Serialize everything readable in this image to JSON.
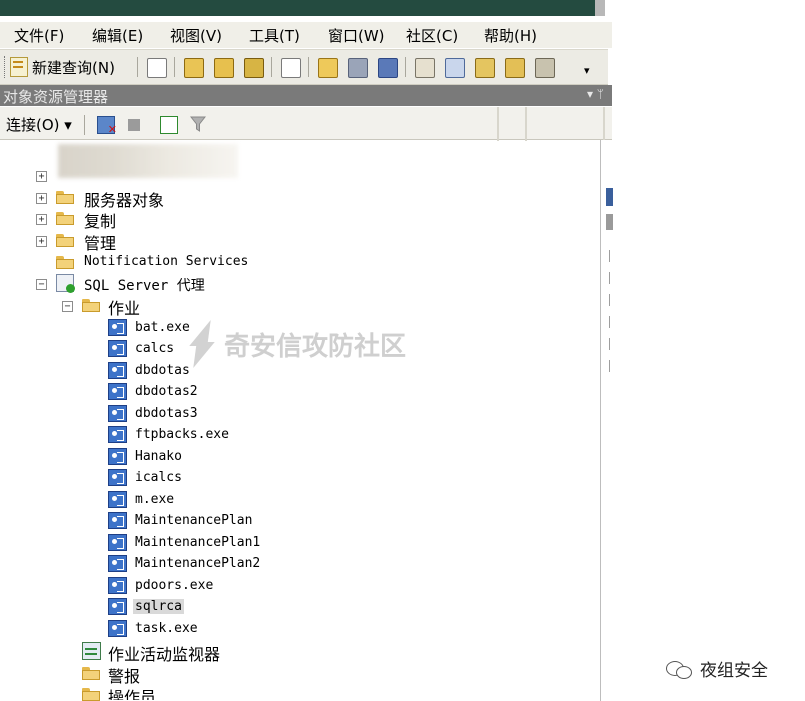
{
  "menu": [
    "文件(F)",
    "编辑(E)",
    "视图(V)",
    "工具(T)",
    "窗口(W)",
    "社区(C)",
    "帮助(H)"
  ],
  "toolbar": {
    "new_query": "新建查询(N)"
  },
  "object_explorer": {
    "title": "对象资源管理器",
    "pin": "▾ ᛘ",
    "connect_label": "连接(O) ▾"
  },
  "tree": {
    "server_objects": "服务器对象",
    "replication": "复制",
    "management": "管理",
    "notification_services": "Notification Services",
    "sql_agent": "SQL Server 代理",
    "jobs": "作业",
    "job_items": [
      "bat.exe",
      "calcs",
      "dbdotas",
      "dbdotas2",
      "dbdotas3",
      "ftpbacks.exe",
      "Hanako",
      "icalcs",
      "m.exe",
      "MaintenancePlan",
      "MaintenancePlan1",
      "MaintenancePlan2",
      "pdoors.exe",
      "sqlrca",
      "task.exe"
    ],
    "selected_job": "sqlrca",
    "activity_monitor": "作业活动监视器",
    "alerts": "警报",
    "operators": "操作员"
  },
  "watermark": "奇安信攻防社区",
  "signature": "夜组安全"
}
